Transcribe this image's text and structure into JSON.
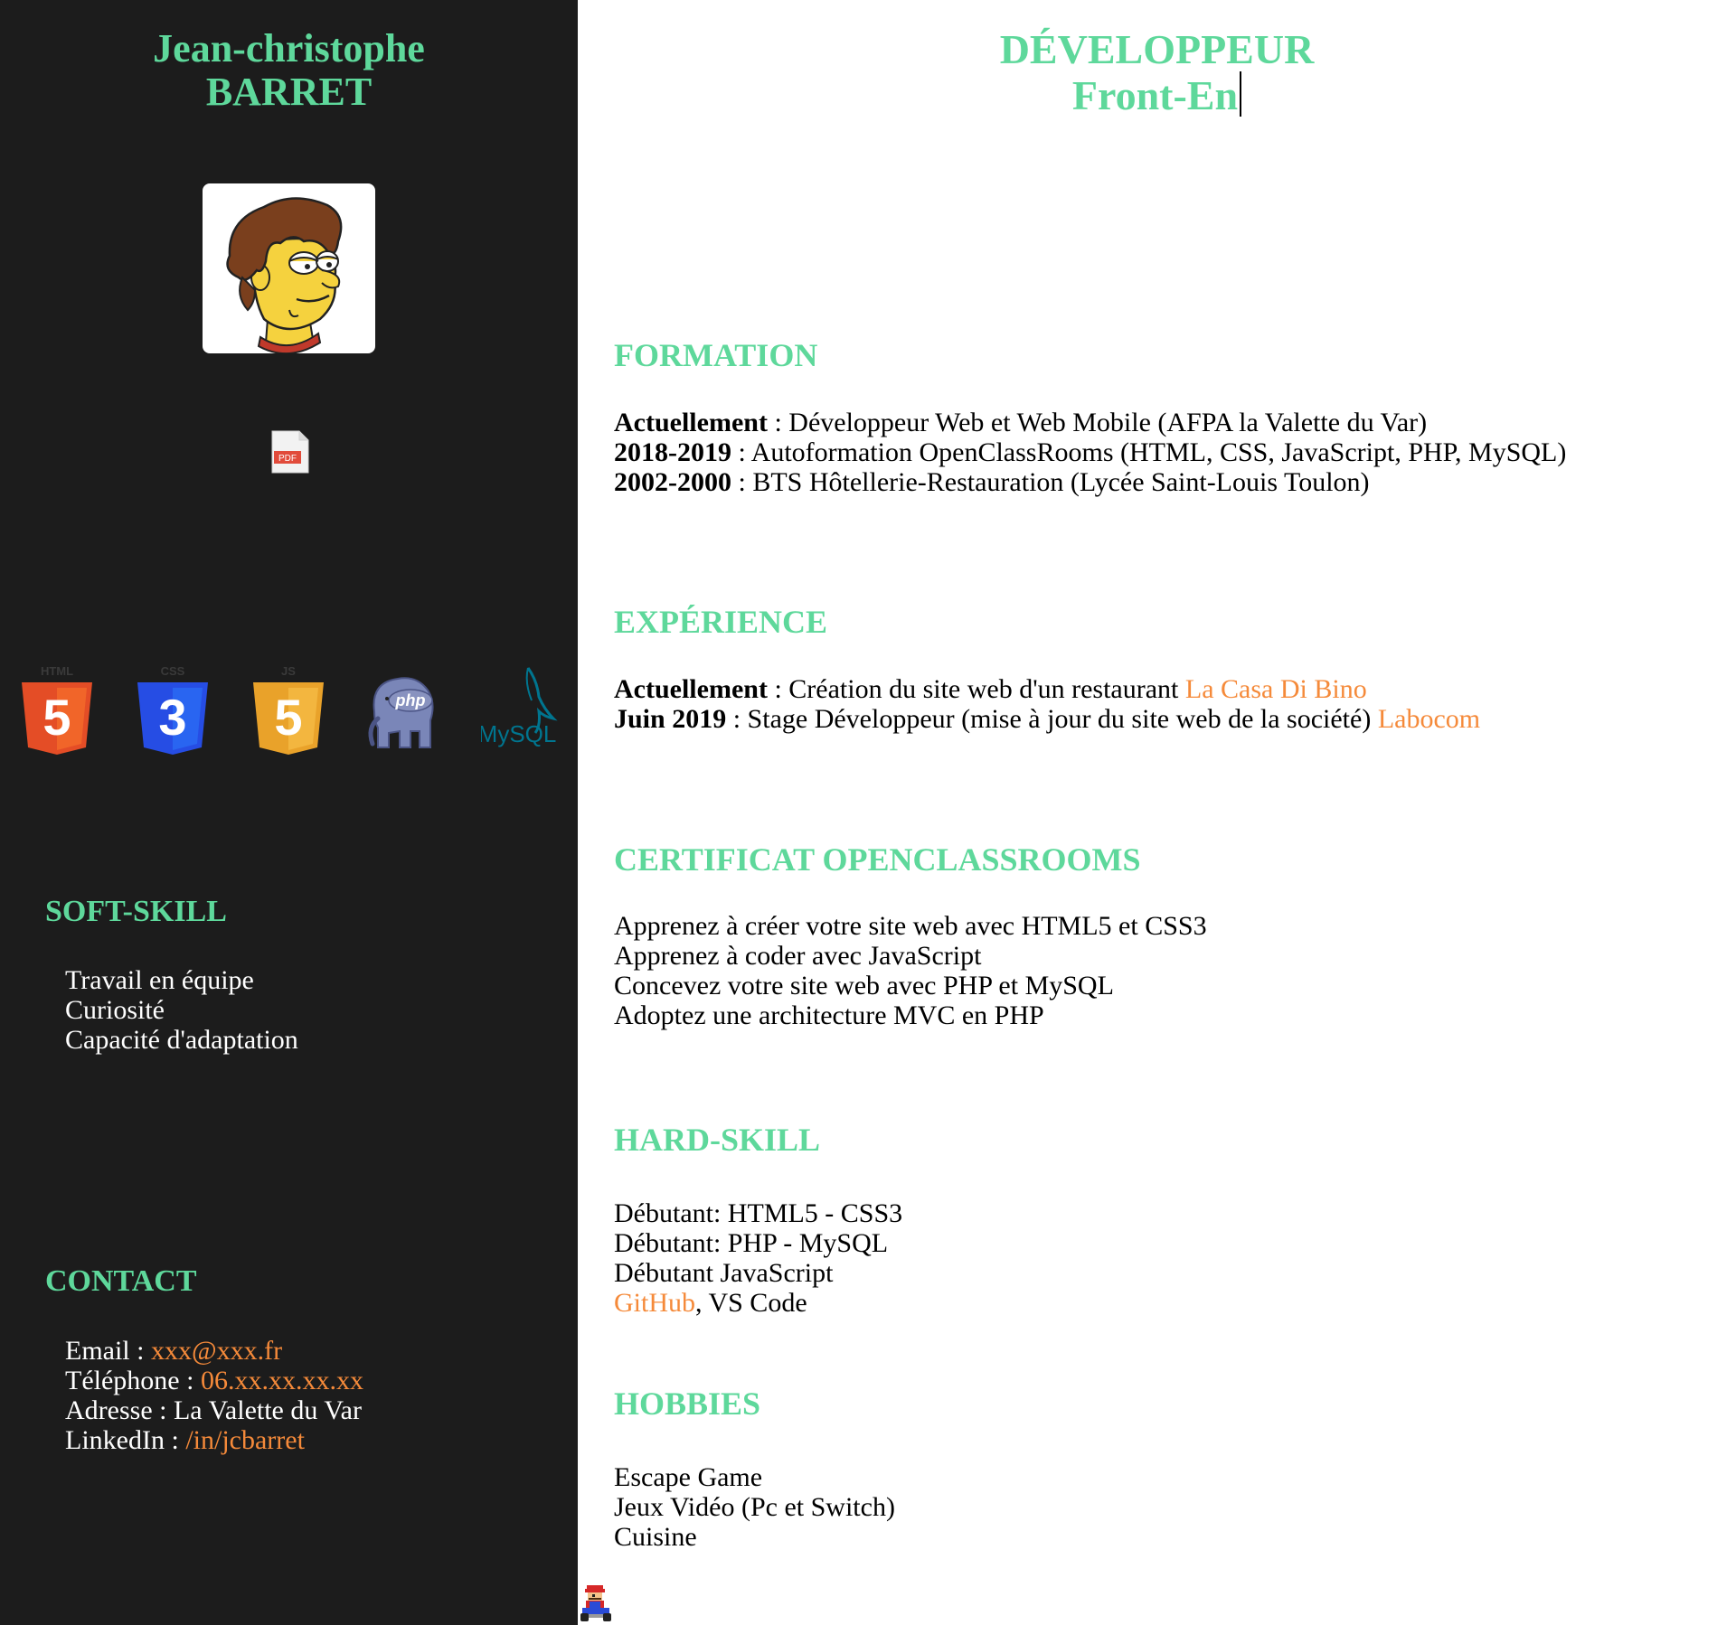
{
  "sidebar": {
    "name_first": "Jean-christophe",
    "name_last": "BARRET",
    "avatar_icon": "cartoon-avatar-icon",
    "pdf_icon": "pdf-icon",
    "pdf_label": "PDF",
    "tech_logos": [
      {
        "name": "html5-logo",
        "label": "HTML",
        "digit": "5",
        "color": "#e44d26"
      },
      {
        "name": "css3-logo",
        "label": "CSS",
        "digit": "3",
        "color": "#264de4"
      },
      {
        "name": "js-logo",
        "label": "JS",
        "digit": "5",
        "color": "#f0a830"
      },
      {
        "name": "php-logo",
        "label": "php",
        "color": "#7a86b8"
      },
      {
        "name": "mysql-logo",
        "label": "MySQL",
        "color": "#00758f"
      }
    ],
    "soft_skill": {
      "heading": "SOFT-SKILL",
      "items": [
        "Travail en équipe",
        "Curiosité",
        "Capacité d'adaptation"
      ]
    },
    "contact": {
      "heading": "CONTACT",
      "email_label": "Email : ",
      "email_value": "xxx@xxx.fr",
      "phone_label": "Téléphone : ",
      "phone_value": "06.xx.xx.xx.xx",
      "address_label": "Adresse : ",
      "address_value": "La Valette du Var",
      "linkedin_label": "LinkedIn : ",
      "linkedin_value": "/in/jcbarret"
    }
  },
  "main": {
    "title_line1": "DÉVELOPPEUR",
    "title_line2": "Front-En",
    "formation": {
      "heading": "FORMATION",
      "items": [
        {
          "term": "Actuellement",
          "text": " : Développeur Web et Web Mobile (AFPA la Valette du Var)"
        },
        {
          "term": "2018-2019",
          "text": " : Autoformation OpenClassRooms (HTML, CSS, JavaScript, PHP, MySQL)"
        },
        {
          "term": "2002-2000",
          "text": " : BTS Hôtellerie-Restauration (Lycée Saint-Louis Toulon)"
        }
      ]
    },
    "experience": {
      "heading": "EXPÉRIENCE",
      "items": [
        {
          "term": "Actuellement",
          "text": " : Création du site web d'un restaurant ",
          "link": "La Casa Di Bino"
        },
        {
          "term": "Juin 2019",
          "text": " : Stage Développeur (mise à jour du site web de la société) ",
          "link": "Labocom"
        }
      ]
    },
    "certificat": {
      "heading": "CERTIFICAT OPENCLASSROOMS",
      "items": [
        "Apprenez à créer votre site web avec HTML5 et CSS3",
        "Apprenez à coder avec JavaScript",
        "Concevez votre site web avec PHP et MySQL",
        "Adoptez une architecture MVC en PHP"
      ]
    },
    "hard_skill": {
      "heading": "HARD-SKILL",
      "items": [
        "Débutant: HTML5 - CSS3",
        "Débutant: PHP - MySQL",
        "Débutant JavaScript"
      ],
      "github_link": "GitHub",
      "github_rest": ", VS Code"
    },
    "hobbies": {
      "heading": "HOBBIES",
      "items": [
        "Escape Game",
        "Jeux Vidéo (Pc et Switch)",
        "Cuisine"
      ]
    }
  },
  "footer": {
    "mascot_icon": "mario-kart-icon"
  },
  "colors": {
    "sidebar_bg": "#1c1c1c",
    "accent_green": "#5ed89b",
    "link_orange": "#f58a3a"
  }
}
